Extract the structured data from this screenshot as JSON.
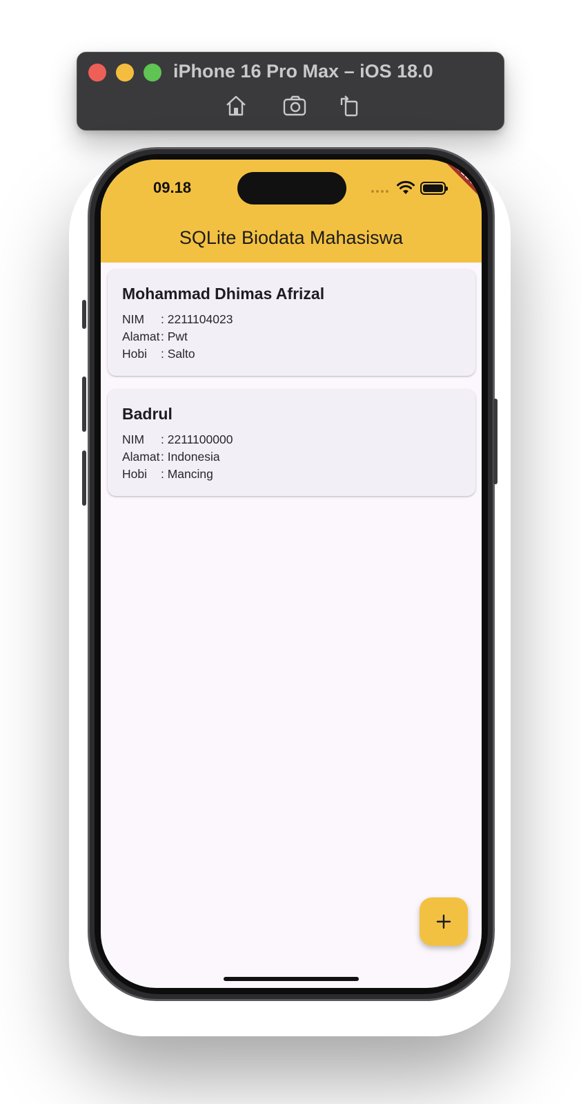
{
  "simulator": {
    "title": "iPhone 16 Pro Max – iOS 18.0",
    "tools": [
      "home-icon",
      "screenshot-icon",
      "rotate-icon"
    ]
  },
  "status_bar": {
    "time": "09.18"
  },
  "debug_banner": "DEBUG",
  "app_bar": {
    "title": "SQLite Biodata Mahasiswa",
    "color": "#f3c142"
  },
  "students": [
    {
      "name": "Mohammad Dhimas Afrizal",
      "nim_label": "NIM",
      "nim": ": 2211104023",
      "alamat_label": "Alamat",
      "alamat": ": Pwt",
      "hobi_label": "Hobi",
      "hobi": ": Salto"
    },
    {
      "name": "Badrul",
      "nim_label": "NIM",
      "nim": ": 2211100000",
      "alamat_label": "Alamat",
      "alamat": ": Indonesia",
      "hobi_label": "Hobi",
      "hobi": ": Mancing"
    }
  ],
  "fab": {
    "icon": "plus-icon"
  }
}
